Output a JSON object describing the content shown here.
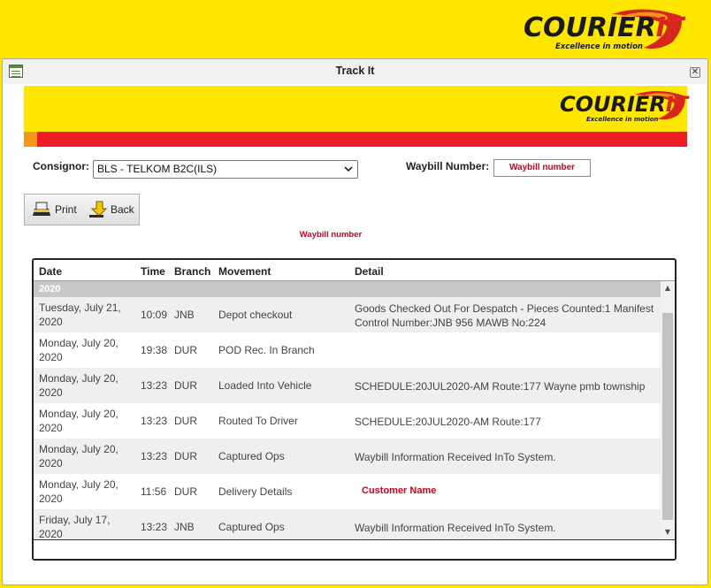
{
  "brand": {
    "logo_word": "COURIER",
    "logo_it": "IT",
    "tagline": "Excellence in motion",
    "colors": {
      "yellow": "#ffe600",
      "red": "#ee1c24",
      "orange": "#f7941d",
      "dark": "#1a1a1a"
    }
  },
  "window": {
    "title": "Track It",
    "close_glyph": "✕"
  },
  "form": {
    "consignor_label": "Consignor:",
    "consignor_value": "BLS - TELKOM B2C(ILS)",
    "waybill_label": "Waybill Number:",
    "waybill_value": "Waybill number"
  },
  "buttons": {
    "print_label": "Print",
    "back_label": "Back"
  },
  "waybill_caption": "Waybill number",
  "grid": {
    "columns": [
      "Date",
      "Time",
      "Branch",
      "Movement",
      "Detail"
    ],
    "partial_row_date": "2020",
    "rows": [
      {
        "date": "Tuesday, July 21, 2020",
        "time": "10:09",
        "branch": "JNB",
        "movement": "Depot checkout",
        "detail": "Goods Checked Out For Despatch - Pieces Counted:1 Manifest Control Number:JNB 956      MAWB No:224"
      },
      {
        "date": "Monday, July 20, 2020",
        "time": "19:38",
        "branch": "DUR",
        "movement": "POD Rec. In Branch",
        "detail": ""
      },
      {
        "date": "Monday, July 20, 2020",
        "time": "13:23",
        "branch": "DUR",
        "movement": "Loaded Into Vehicle",
        "detail": "SCHEDULE:20JUL2020-AM Route:177 Wayne pmb township"
      },
      {
        "date": "Monday, July 20, 2020",
        "time": "13:23",
        "branch": "DUR",
        "movement": "Routed To Driver",
        "detail": "SCHEDULE:20JUL2020-AM Route:177"
      },
      {
        "date": "Monday, July 20, 2020",
        "time": "13:23",
        "branch": "DUR",
        "movement": "Captured Ops",
        "detail": "Waybill Information Received InTo System."
      },
      {
        "date": "Monday, July 20, 2020",
        "time": "11:56",
        "branch": "DUR",
        "movement": "Delivery Details",
        "detail": "Customer Name"
      },
      {
        "date": "Friday, July 17, 2020",
        "time": "13:23",
        "branch": "JNB",
        "movement": "Captured Ops",
        "detail": "Waybill Information Received InTo System."
      }
    ]
  },
  "scrollbar": {
    "up_glyph": "▲",
    "down_glyph": "▼"
  }
}
